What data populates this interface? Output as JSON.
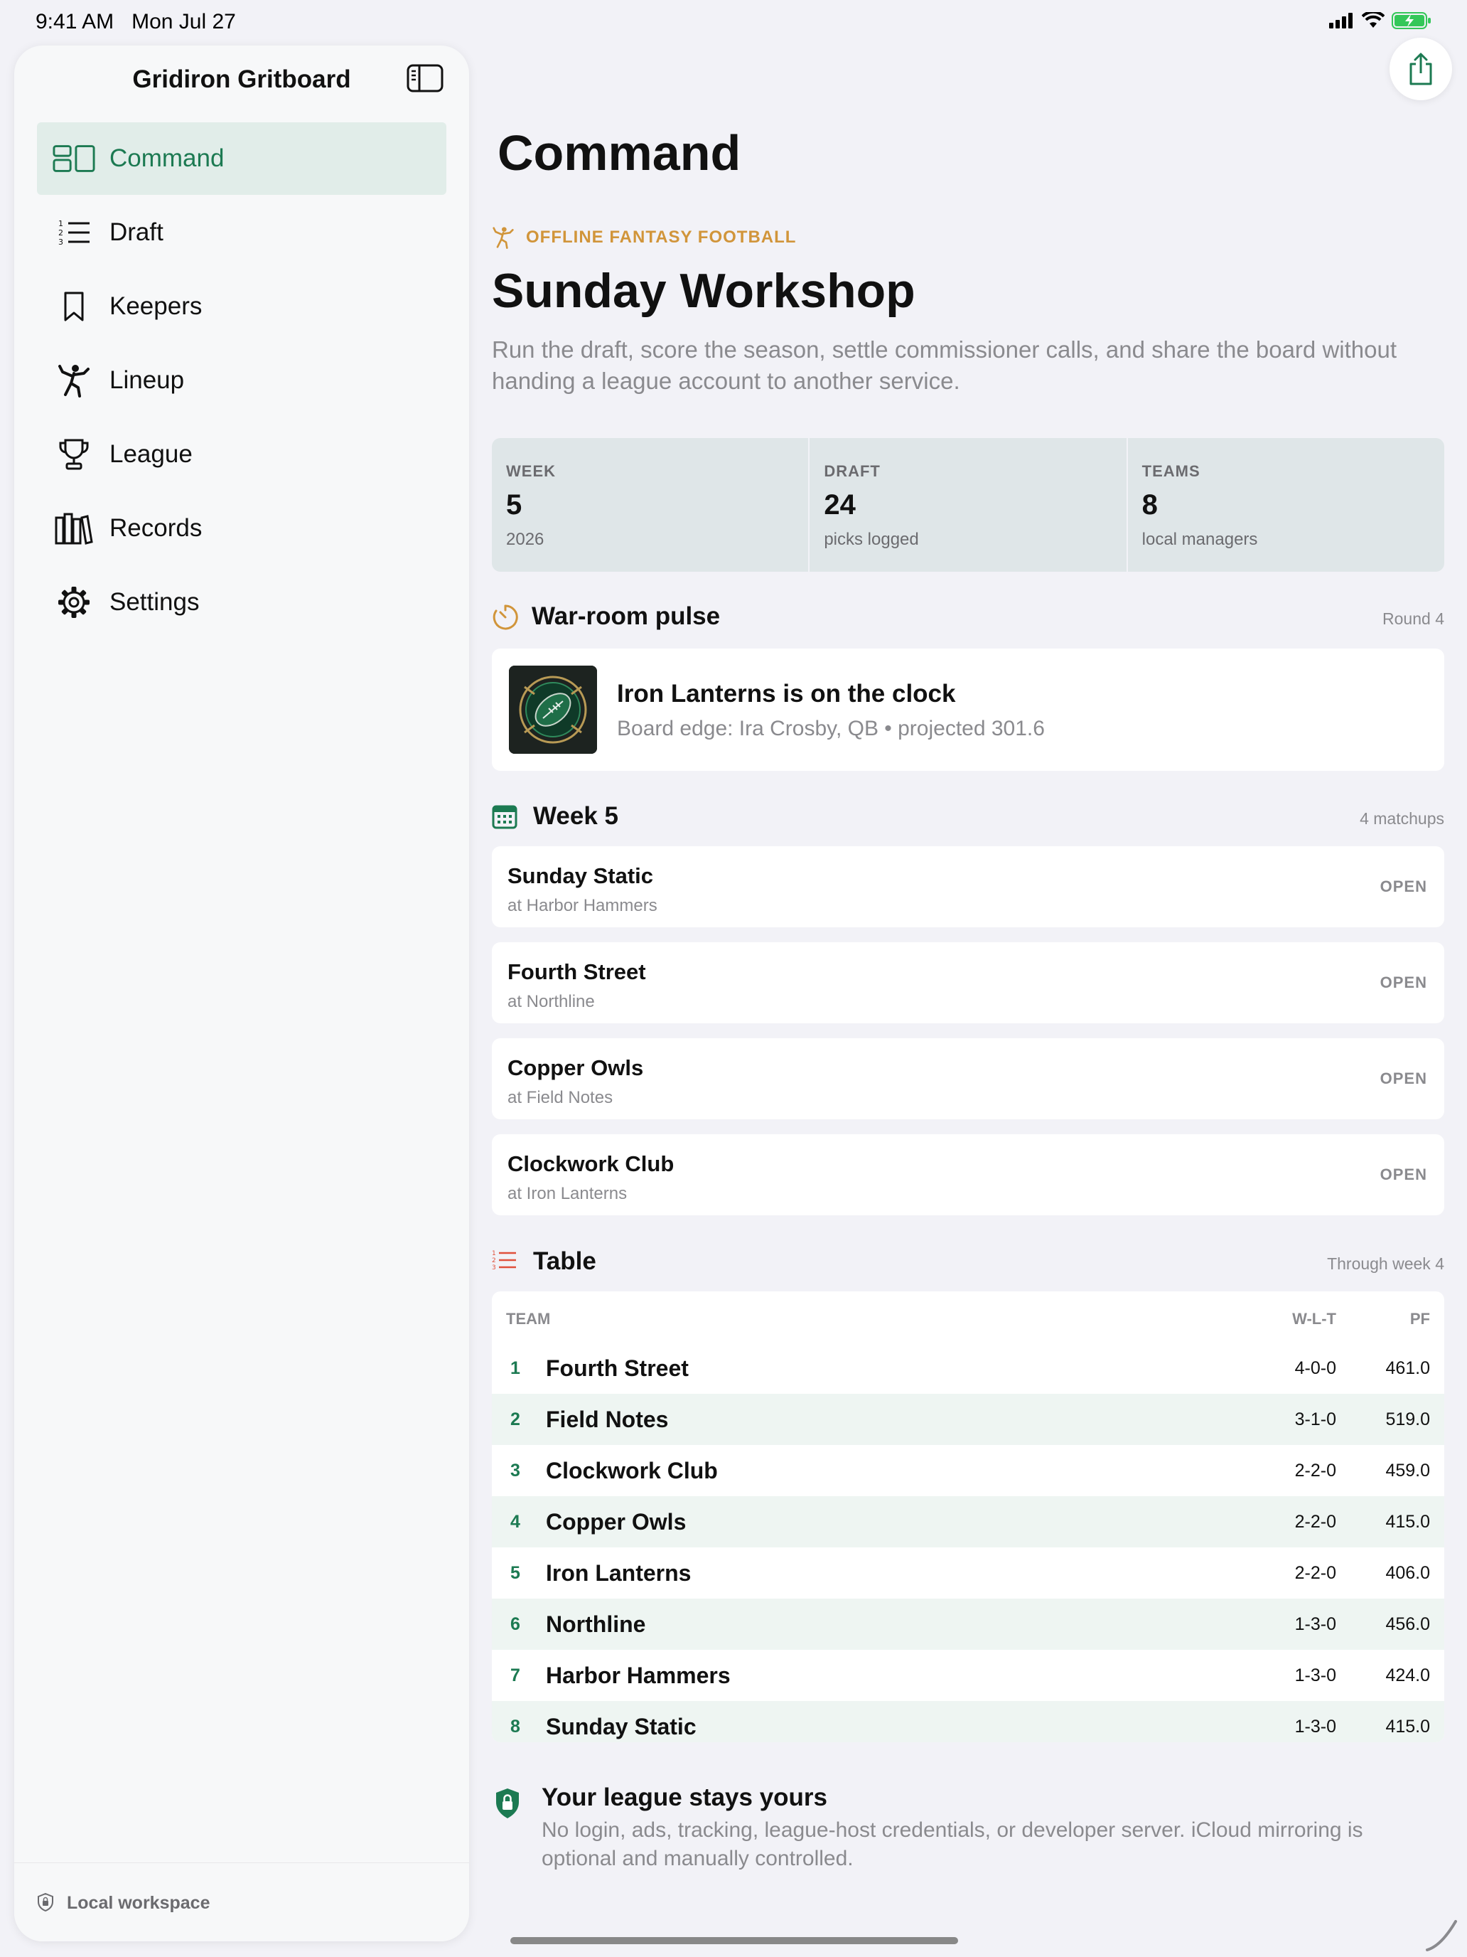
{
  "status_bar": {
    "time": "9:41 AM",
    "date": "Mon Jul 27"
  },
  "sidebar": {
    "title": "Gridiron Gritboard",
    "items": [
      {
        "label": "Command",
        "icon": "command-icon",
        "active": true
      },
      {
        "label": "Draft",
        "icon": "numbered-list-icon",
        "active": false
      },
      {
        "label": "Keepers",
        "icon": "bookmark-icon",
        "active": false
      },
      {
        "label": "Lineup",
        "icon": "player-throwing-icon",
        "active": false
      },
      {
        "label": "League",
        "icon": "trophy-icon",
        "active": false
      },
      {
        "label": "Records",
        "icon": "books-icon",
        "active": false
      },
      {
        "label": "Settings",
        "icon": "gear-icon",
        "active": false
      }
    ],
    "footer": "Local workspace"
  },
  "main": {
    "page_title": "Command",
    "kicker": "OFFLINE FANTASY FOOTBALL",
    "hero_title": "Sunday Workshop",
    "hero_description": "Run the draft, score the season, settle commissioner calls, and share the board without handing a league account to another service.",
    "stats": [
      {
        "key": "WEEK",
        "value": "5",
        "sub": "2026"
      },
      {
        "key": "DRAFT",
        "value": "24",
        "sub": "picks logged"
      },
      {
        "key": "TEAMS",
        "value": "8",
        "sub": "local managers"
      }
    ],
    "pulse": {
      "title": "War-room pulse",
      "meta": "Round 4",
      "card_title": "Iron Lanterns is on the clock",
      "card_subtitle": "Board edge: Ira Crosby, QB • projected 301.6"
    },
    "week": {
      "title": "Week 5",
      "meta": "4 matchups",
      "matchups": [
        {
          "team": "Sunday Static",
          "opponent": "at Harbor Hammers",
          "status": "OPEN"
        },
        {
          "team": "Fourth Street",
          "opponent": "at Northline",
          "status": "OPEN"
        },
        {
          "team": "Copper Owls",
          "opponent": "at Field Notes",
          "status": "OPEN"
        },
        {
          "team": "Clockwork Club",
          "opponent": "at Iron Lanterns",
          "status": "OPEN"
        }
      ]
    },
    "table": {
      "title": "Table",
      "meta": "Through week 4",
      "columns": {
        "team": "TEAM",
        "wlt": "W-L-T",
        "pf": "PF"
      },
      "rows": [
        {
          "rank": "1",
          "team": "Fourth Street",
          "wlt": "4-0-0",
          "pf": "461.0"
        },
        {
          "rank": "2",
          "team": "Field Notes",
          "wlt": "3-1-0",
          "pf": "519.0"
        },
        {
          "rank": "3",
          "team": "Clockwork Club",
          "wlt": "2-2-0",
          "pf": "459.0"
        },
        {
          "rank": "4",
          "team": "Copper Owls",
          "wlt": "2-2-0",
          "pf": "415.0"
        },
        {
          "rank": "5",
          "team": "Iron Lanterns",
          "wlt": "2-2-0",
          "pf": "406.0"
        },
        {
          "rank": "6",
          "team": "Northline",
          "wlt": "1-3-0",
          "pf": "456.0"
        },
        {
          "rank": "7",
          "team": "Harbor Hammers",
          "wlt": "1-3-0",
          "pf": "424.0"
        },
        {
          "rank": "8",
          "team": "Sunday Static",
          "wlt": "1-3-0",
          "pf": "415.0"
        }
      ]
    },
    "privacy": {
      "title": "Your league stays yours",
      "description": "No login, ads, tracking, league-host credentials, or developer server. iCloud mirroring is optional and manually controlled."
    }
  },
  "colors": {
    "accent": "#1c7a52",
    "kicker": "#d1953a",
    "table_accent": "#e0503c",
    "active_nav_bg": "#e1ede9",
    "stats_bg": "#dfe6e8"
  }
}
